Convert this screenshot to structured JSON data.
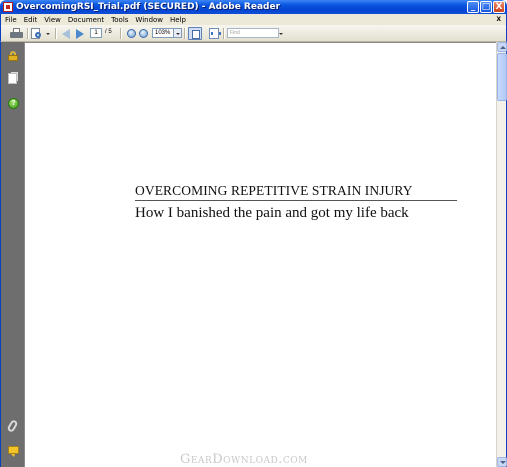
{
  "window": {
    "title": "OvercomingRSI_Trial.pdf (SECURED) - Adobe Reader",
    "minimize_label": "_",
    "maximize_label": "□",
    "close_label": "X"
  },
  "menu": {
    "items": [
      "File",
      "Edit",
      "View",
      "Document",
      "Tools",
      "Window",
      "Help"
    ],
    "close_label": "x"
  },
  "toolbar": {
    "current_page": "1",
    "total_pages": "/ 5",
    "zoom": "103%",
    "find_placeholder": "Find",
    "icons": [
      "printer-icon",
      "search-doc-icon",
      "prev-page-icon",
      "next-page-icon",
      "zoom-out-icon",
      "zoom-in-icon",
      "fit-page-icon",
      "fit-width-icon"
    ]
  },
  "navpanel": {
    "icons": [
      "lock-icon",
      "pages-icon",
      "help-icon",
      "attach-icon",
      "comments-icon"
    ],
    "help_glyph": "?"
  },
  "document": {
    "title": "OVERCOMING REPETITIVE STRAIN INJURY",
    "subtitle": "How I banished the pain and got my life back"
  },
  "watermark": "GearDownload.com"
}
